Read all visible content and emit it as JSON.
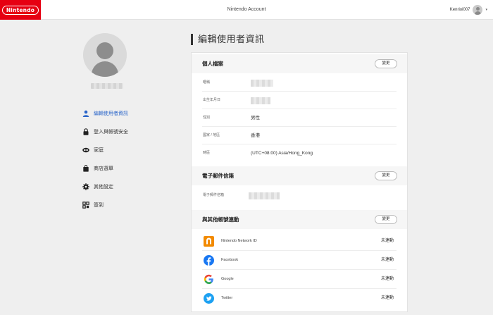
{
  "header": {
    "logo_text": "Nintendo",
    "title": "Nintendo Account",
    "username": "Kenrioi007",
    "caret": "▾"
  },
  "page": {
    "title": "編輯使用者資訊"
  },
  "sidebar": {
    "items": [
      {
        "label": "編輯使用者資訊",
        "icon": "person-icon",
        "active": true
      },
      {
        "label": "登入與帳號安全",
        "icon": "lock-icon",
        "active": false
      },
      {
        "label": "家庭",
        "icon": "family-icon",
        "active": false
      },
      {
        "label": "商店選單",
        "icon": "shopping-bag-icon",
        "active": false
      },
      {
        "label": "其他設定",
        "icon": "gear-icon",
        "active": false
      },
      {
        "label": "簽到",
        "icon": "checkin-grid-icon",
        "active": false
      }
    ]
  },
  "profile": {
    "title": "個人檔案",
    "edit_label": "變更",
    "fields": [
      {
        "label": "暱稱",
        "value": ""
      },
      {
        "label": "出生年月日",
        "value": ""
      },
      {
        "label": "性別",
        "value": "男性"
      },
      {
        "label": "國家 / 地區",
        "value": "香港"
      },
      {
        "label": "時區",
        "value": "(UTC+08:00) Asia/Hong_Kong"
      }
    ]
  },
  "email": {
    "title": "電子郵件信箱",
    "edit_label": "變更",
    "field_label": "電子郵件信箱"
  },
  "linked": {
    "title": "與其他帳號連動",
    "edit_label": "變更",
    "services": [
      {
        "name": "Nintendo Network ID",
        "status": "未連動",
        "icon": "nintendo-network-icon",
        "color": "#f28a00"
      },
      {
        "name": "Facebook",
        "status": "未連動",
        "icon": "facebook-icon",
        "color": "#1877f2"
      },
      {
        "name": "Google",
        "status": "未連動",
        "icon": "google-icon",
        "color": "#4285f4"
      },
      {
        "name": "Twitter",
        "status": "未連動",
        "icon": "twitter-icon",
        "color": "#1da1f2"
      }
    ]
  },
  "colors": {
    "brand_red": "#e60012",
    "active_nav": "#2a65c9"
  }
}
